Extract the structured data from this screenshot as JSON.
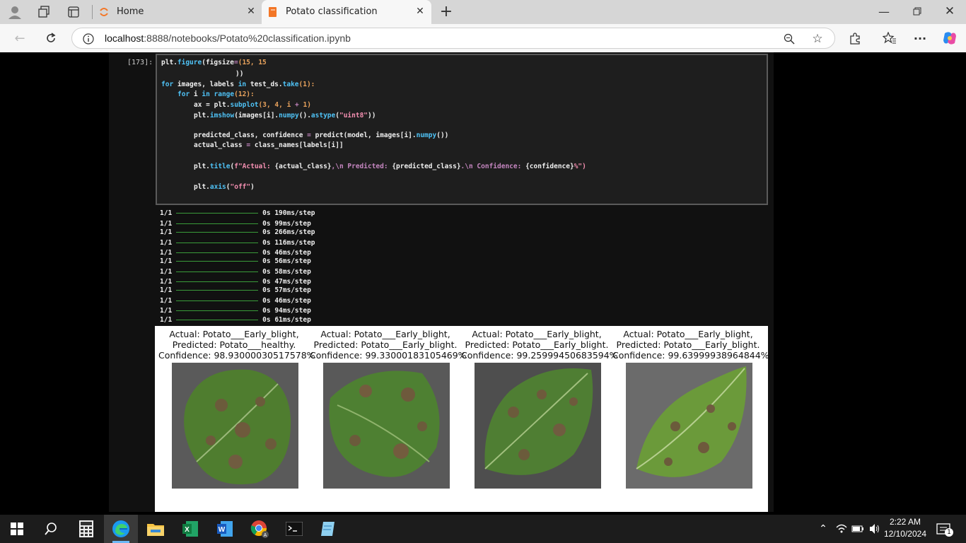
{
  "browser": {
    "tabs": [
      {
        "label": "Home",
        "active": false
      },
      {
        "label": "Potato classification",
        "active": true
      }
    ],
    "url_host": "localhost",
    "url_path": ":8888/notebooks/Potato%20classification.ipynb",
    "icons": [
      "profile-icon",
      "workspaces-icon",
      "tab-actions-icon",
      "back-icon",
      "refresh-icon",
      "site-info-icon",
      "zoom-icon",
      "favorite-star-icon",
      "extensions-icon",
      "favorites-icon",
      "more-icon",
      "copilot-icon"
    ]
  },
  "notebook": {
    "prompt": "[173]:",
    "code": [
      [
        "plt.",
        "figure",
        "(figsize",
        "=",
        "(15, 15"
      ],
      [
        "))"
      ],
      [
        "for",
        " images, labels ",
        "in",
        " test_ds.",
        "take",
        "(1):"
      ],
      [
        "for",
        " i ",
        "in",
        " range",
        "(12):"
      ],
      [
        "ax = plt.",
        "subplot",
        "(3, 4, i ",
        "+",
        " 1)"
      ],
      [
        "plt.",
        "imshow",
        "(images[i].",
        "numpy",
        "().",
        "astype",
        "(",
        "\"uint8\"",
        "))"
      ],
      [
        "predicted_class, confidence ",
        "=",
        " predict(model, images[i].",
        "numpy",
        "())"
      ],
      [
        "actual_class ",
        "=",
        " class_names[labels[i]]"
      ],
      [
        "plt.",
        "title",
        "(",
        "f\"Actual: ",
        "{actual_class}",
        ",\\n Predicted: ",
        "{predicted_class}",
        ".\\n Confidence: ",
        "{confidence}",
        "%\")"
      ],
      [
        "plt.",
        "axis",
        "(",
        "\"off\"",
        ")"
      ]
    ],
    "output_steps": [
      {
        "step": "1/1",
        "time": "0s 190ms/step"
      },
      {
        "step": "1/1",
        "time": "0s 99ms/step"
      },
      {
        "step": "1/1",
        "time": "0s 266ms/step"
      },
      {
        "step": "1/1",
        "time": "0s 116ms/step"
      },
      {
        "step": "1/1",
        "time": "0s 46ms/step"
      },
      {
        "step": "1/1",
        "time": "0s 56ms/step"
      },
      {
        "step": "1/1",
        "time": "0s 58ms/step"
      },
      {
        "step": "1/1",
        "time": "0s 47ms/step"
      },
      {
        "step": "1/1",
        "time": "0s 57ms/step"
      },
      {
        "step": "1/1",
        "time": "0s 46ms/step"
      },
      {
        "step": "1/1",
        "time": "0s 94ms/step"
      },
      {
        "step": "1/1",
        "time": "0s 61ms/step"
      }
    ],
    "figures": [
      {
        "line1": "Actual: Potato___Early_blight,",
        "line2": "Predicted: Potato___healthy.",
        "line3": "Confidence: 98.93000030517578%"
      },
      {
        "line1": "Actual: Potato___Early_blight,",
        "line2": "Predicted: Potato___Early_blight.",
        "line3": "Confidence: 99.33000183105469%"
      },
      {
        "line1": "Actual: Potato___Early_blight,",
        "line2": "Predicted: Potato___Early_blight.",
        "line3": "Confidence: 99.25999450683594%"
      },
      {
        "line1": "Actual: Potato___Early_blight,",
        "line2": "Predicted: Potato___Early_blight.",
        "line3": "Confidence: 99.63999938964844%"
      }
    ]
  },
  "taskbar": {
    "time": "2:22 AM",
    "date": "12/10/2024",
    "notifications": "1",
    "apps": [
      "start-icon",
      "search-icon",
      "calculator-icon",
      "edge-icon",
      "file-explorer-icon",
      "excel-icon",
      "word-icon",
      "chrome-icon",
      "terminal-icon",
      "notepad-icon"
    ]
  },
  "colors": {
    "accent": "#0067c0",
    "code_keyword": "#4fc3f7",
    "string": "#f48fb1",
    "number": "#e8a25c"
  }
}
